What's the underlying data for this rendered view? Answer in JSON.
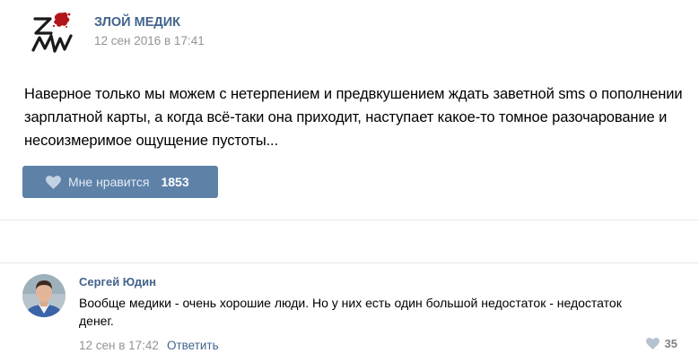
{
  "post": {
    "author": "ЗЛОЙ МЕДИК",
    "date": "12 сен 2016 в 17:41",
    "text": "Наверное только мы можем с нетерпением и предвкушением ждать заветной sms о пополнении зарплатной карты, а когда всё-таки она приходит, наступает какое-то томное разочарование и несоизмеримое ощущение пустоты...",
    "like_label": "Мне нравится",
    "like_count": "1853"
  },
  "comment": {
    "author": "Сергей Юдин",
    "text": "Вообще медики - очень хорошие люди. Но у них есть один большой недостаток - недостаток денег.",
    "date": "12 сен в 17:42",
    "reply_label": "Ответить",
    "like_count": "35"
  },
  "colors": {
    "link": "#42648b",
    "like_button": "#5e81a8",
    "muted": "#939393",
    "divider": "#e7e8ec"
  },
  "icons": {
    "logo": "zm-logo-with-blot",
    "like": "heart-icon"
  }
}
